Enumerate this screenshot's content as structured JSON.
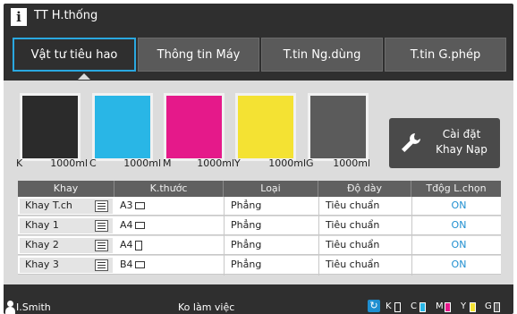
{
  "title": "TT H.thống",
  "icons": {
    "info": "info-icon",
    "wrench": "wrench-icon",
    "list": "list-icon",
    "user": "user-icon",
    "refresh": "refresh-icon"
  },
  "info_glyph": "i",
  "tabs": [
    {
      "label": "Vật tư tiêu hao",
      "active": true
    },
    {
      "label": "Thông tin Máy",
      "active": false
    },
    {
      "label": "T.tin Ng.dùng",
      "active": false
    },
    {
      "label": "T.tin G.phép",
      "active": false
    }
  ],
  "consumables": [
    {
      "letter": "K",
      "amount": "1000ml",
      "color": "#2b2b2b"
    },
    {
      "letter": "C",
      "amount": "1000ml",
      "color": "#29b6e6"
    },
    {
      "letter": "M",
      "amount": "1000ml",
      "color": "#e5198a"
    },
    {
      "letter": "Y",
      "amount": "1000ml",
      "color": "#f4e233"
    },
    {
      "letter": "G",
      "amount": "1000ml",
      "color": "#5b5b5b"
    }
  ],
  "tray_button": {
    "label": "Cài đặt\nKhay Nạp"
  },
  "table": {
    "headers": [
      "Khay",
      "K.thước",
      "Loại",
      "Độ dày",
      "Tđộg L.chọn"
    ],
    "rows": [
      {
        "tray": "Khay T.ch",
        "size": "A3",
        "orientation": "landscape",
        "type": "Phẳng",
        "thickness": "Tiêu chuẩn",
        "auto": "ON"
      },
      {
        "tray": "Khay 1",
        "size": "A4",
        "orientation": "landscape",
        "type": "Phẳng",
        "thickness": "Tiêu chuẩn",
        "auto": "ON"
      },
      {
        "tray": "Khay 2",
        "size": "A4",
        "orientation": "portrait",
        "type": "Phẳng",
        "thickness": "Tiêu chuẩn",
        "auto": "ON"
      },
      {
        "tray": "Khay 3",
        "size": "B4",
        "orientation": "landscape",
        "type": "Phẳng",
        "thickness": "Tiêu chuẩn",
        "auto": "ON"
      }
    ]
  },
  "status": {
    "user": "I.Smith",
    "state": "Ko làm việc",
    "refresh_glyph": "↻",
    "inks": [
      {
        "letter": "K",
        "color": "#2b2b2b"
      },
      {
        "letter": "C",
        "color": "#29b6e6"
      },
      {
        "letter": "M",
        "color": "#e5198a"
      },
      {
        "letter": "Y",
        "color": "#f4e233"
      },
      {
        "letter": "G",
        "color": "#5b5b5b"
      }
    ]
  }
}
